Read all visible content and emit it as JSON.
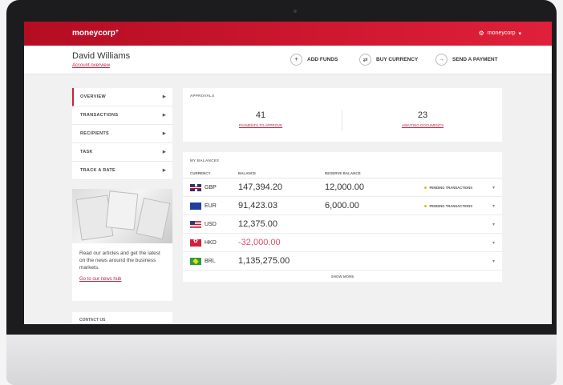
{
  "app": {
    "logo": "moneycorp",
    "logo_mark": "+",
    "company_menu": "moneycorp"
  },
  "header": {
    "user_name": "David Williams",
    "account_link": "Account overview",
    "actions": {
      "add_funds": "ADD FUNDS",
      "buy_currency": "BUY CURRENCY",
      "send_payment": "SEND A PAYMENT"
    }
  },
  "sidebar": {
    "items": [
      {
        "label": "OVERVIEW"
      },
      {
        "label": "TRANSACTIONS"
      },
      {
        "label": "RECIPIENTS"
      },
      {
        "label": "TASK"
      },
      {
        "label": "TRACK A RATE"
      }
    ],
    "promo_text": "Read our articles and get the latest on the news around the business markets.",
    "promo_link": "Go to our news hub",
    "contact": "CONTACT US"
  },
  "approvals": {
    "title": "APPROVALS",
    "payments_count": "41",
    "payments_label": "PAYMENTS TO APPROVE",
    "documents_count": "23",
    "documents_label": "AWAITING DOCUMENTS"
  },
  "balances": {
    "title": "MY BALANCES",
    "headers": {
      "currency": "CURRENCY",
      "balance": "BALANCE",
      "reserve": "RESERVE BALANCE"
    },
    "rows": [
      {
        "currency": "GBP",
        "balance": "147,394.20",
        "reserve": "12,000.00",
        "status": "PENDING TRANSACTIONS"
      },
      {
        "currency": "EUR",
        "balance": "91,423.03",
        "reserve": "6,000.00",
        "status": "PENDING TRANSACTIONS"
      },
      {
        "currency": "USD",
        "balance": "12,375.00",
        "reserve": "",
        "status": ""
      },
      {
        "currency": "HKD",
        "balance": "-32,000.00",
        "reserve": "",
        "status": ""
      },
      {
        "currency": "BRL",
        "balance": "1,135,275.00",
        "reserve": "",
        "status": ""
      }
    ],
    "show_more": "SHOW MORE"
  },
  "colors": {
    "brand_red": "#d1203a",
    "pending_dot": "#f5b400"
  }
}
